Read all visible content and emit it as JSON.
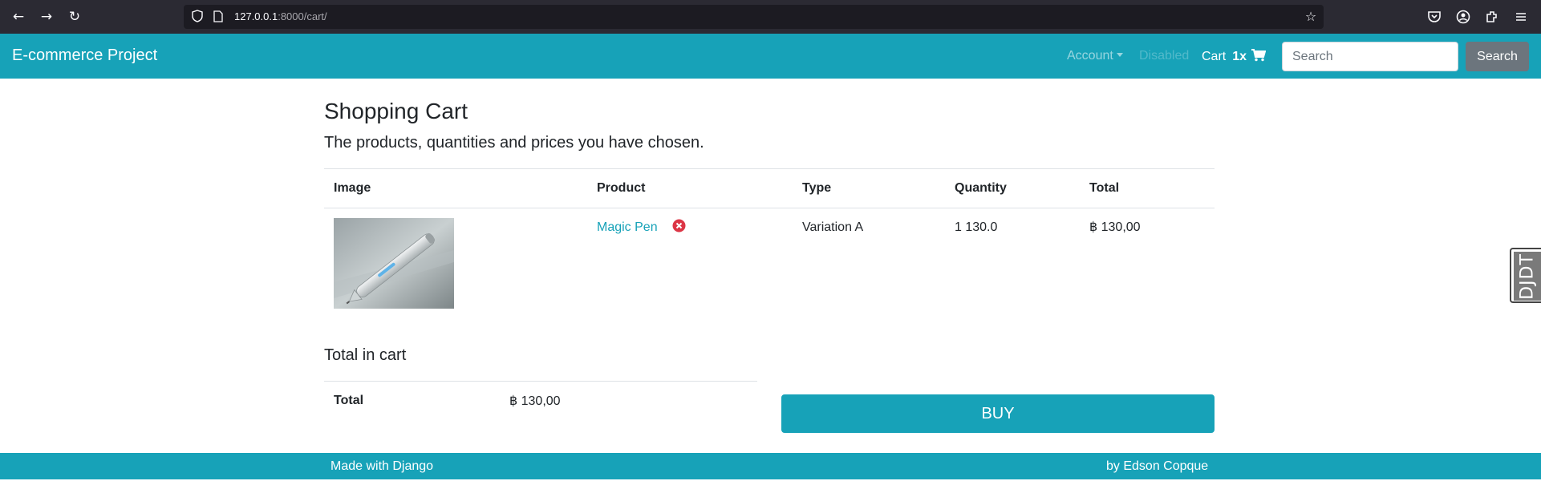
{
  "browser": {
    "url_host": "127.0.0.1",
    "url_rest": ":8000/cart/"
  },
  "navbar": {
    "brand": "E-commerce Project",
    "account_label": "Account",
    "disabled_label": "Disabled",
    "cart_label": "Cart",
    "cart_count": "1x",
    "search_placeholder": "Search",
    "search_button": "Search"
  },
  "main": {
    "title": "Shopping Cart",
    "lead": "The products, quantities and prices you have chosen.",
    "table": {
      "headers": [
        "Image",
        "Product",
        "Type",
        "Quantity",
        "Total"
      ],
      "rows": [
        {
          "product": "Magic Pen",
          "type": "Variation A",
          "quantity": "1 130.0",
          "total": "฿ 130,00"
        }
      ]
    },
    "totals": {
      "heading": "Total in cart",
      "label": "Total",
      "value": "฿ 130,00"
    },
    "buy_button": "BUY"
  },
  "footer": {
    "left": "Made with Django",
    "right": "by Edson Copque"
  },
  "debug_toolbar": {
    "label": "DJDT"
  },
  "colors": {
    "primary": "#17a2b8",
    "secondary": "#6c757d",
    "danger": "#dc3545"
  }
}
